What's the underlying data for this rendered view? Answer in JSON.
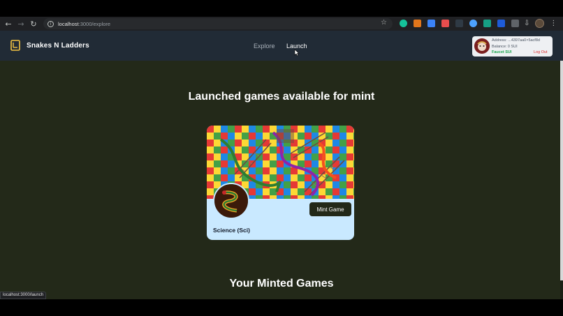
{
  "browser": {
    "url_host": "localhost",
    "url_path": ":3000/explore",
    "status_url": "localhost:3000/launch"
  },
  "header": {
    "brand": "Snakes N Ladders",
    "nav": {
      "explore": "Explore",
      "launch": "Launch"
    },
    "wallet": {
      "address": "Address: ...4397aa0×5acf8d",
      "balance": "Balance: 0 SUI",
      "faucet": "Faucet SUI",
      "logout": "Log Out"
    }
  },
  "main": {
    "launched_heading": "Launched games available for mint",
    "minted_heading": "Your Minted Games",
    "games": [
      {
        "title": "Science (Sci)",
        "mint_label": "Mint Game"
      }
    ]
  },
  "colors": {
    "page_bg": "#232919",
    "header_bg": "#212b36",
    "card_bg": "#c9e9ff",
    "button_bg": "#232919",
    "faucet": "#16a34a",
    "logout": "#dc2626"
  }
}
